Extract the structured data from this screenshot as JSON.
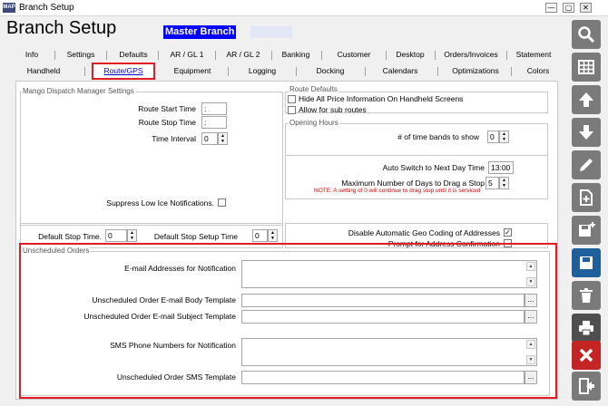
{
  "window": {
    "title": "Branch Setup",
    "logo_text": "MAP",
    "min": "—",
    "max": "▢",
    "close": "✕"
  },
  "header": {
    "title": "Branch Setup",
    "branch": "Master Branch"
  },
  "tabs_row1": [
    "Info",
    "Settings",
    "Defaults",
    "AR / GL 1",
    "AR / GL 2",
    "Banking",
    "Customer",
    "Desktop",
    "Orders/Invoices",
    "Statement"
  ],
  "tabs_row2": [
    "Handheld",
    "Route/GPS",
    "Equipment",
    "Logging",
    "Docking",
    "Calendars",
    "Optimizations",
    "Colors"
  ],
  "mango": {
    "legend": "Mango Dispatch Manager Settings",
    "route_start_label": "Route Start Time",
    "route_start_value": ":",
    "route_stop_label": "Route Stop Time",
    "route_stop_value": ":",
    "time_interval_label": "Time Interval",
    "time_interval_value": "0",
    "suppress_label": "Suppress Low Ice Notifications."
  },
  "route_defaults": {
    "legend": "Route Defaults",
    "hide_price_label": "Hide All Price Information On Handheld Screens",
    "sub_routes_label": "Allow for sub routes"
  },
  "opening_hours": {
    "legend": "Opening Hours",
    "time_bands_label": "# of time bands to show",
    "time_bands_value": "0"
  },
  "auto_switch": {
    "label": "Auto Switch to Next Day Time",
    "value": "13:00",
    "max_days_label": "Maximum Number of Days to Drag a Stop",
    "max_days_value": "5",
    "note": "NOTE: A setting of 0 will continue to drag stop until it is serviced"
  },
  "stops": {
    "default_stop_label": "Default Stop Time.",
    "default_stop_value": "0",
    "setup_label": "Default Stop Setup Time",
    "setup_value": "0"
  },
  "geo": {
    "disable_label": "Disable Automatic Geo Coding of Addresses",
    "disable_checked": "✓",
    "prompt_label": "Prompt for Address Confirmation"
  },
  "unscheduled": {
    "legend": "Unscheduled Orders",
    "email_label": "E-mail Addresses for Notification",
    "body_label": "Unscheduled Order E-mail Body Template",
    "subject_label": "Unscheduled Order E-mail Subject Template",
    "sms_label": "SMS Phone Numbers for Notification",
    "sms_template_label": "Unscheduled Order SMS Template",
    "ellipsis": "..."
  },
  "toolbar": [
    "search-icon",
    "grid-icon",
    "up-arrow-icon",
    "down-arrow-icon",
    "pencil-icon",
    "new-document-icon",
    "save-new-icon",
    "save-icon",
    "trash-icon",
    "printer-icon",
    "close-icon",
    "exit-icon"
  ],
  "colors": {
    "accent_red": "#e31b23",
    "branch_blue": "#0000ff",
    "note_red": "#e00000"
  }
}
